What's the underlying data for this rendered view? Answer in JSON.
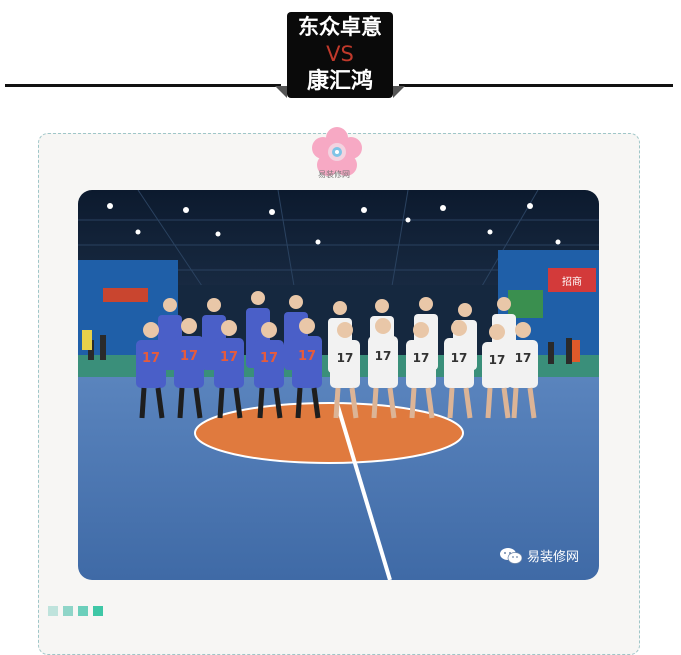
{
  "header": {
    "team_home": "东众卓意",
    "vs_label": "VS",
    "team_away": "康汇鸿"
  },
  "logo": {
    "caption": "易装修网"
  },
  "photo": {
    "jersey_number": "17",
    "watermark_text": "易装修网",
    "banner_text": "招商"
  },
  "colors": {
    "accent_red": "#c0392b",
    "card_border": "#9fc6c8",
    "team_blue_jersey": "#4a5fc8",
    "team_white_jersey": "#f2f2f2",
    "court_orange": "#e07a3e",
    "court_blue": "#4f7cb8",
    "dots": [
      "#bfe3dc",
      "#8fd5c8",
      "#6ccfbb",
      "#3fc7a6"
    ]
  }
}
